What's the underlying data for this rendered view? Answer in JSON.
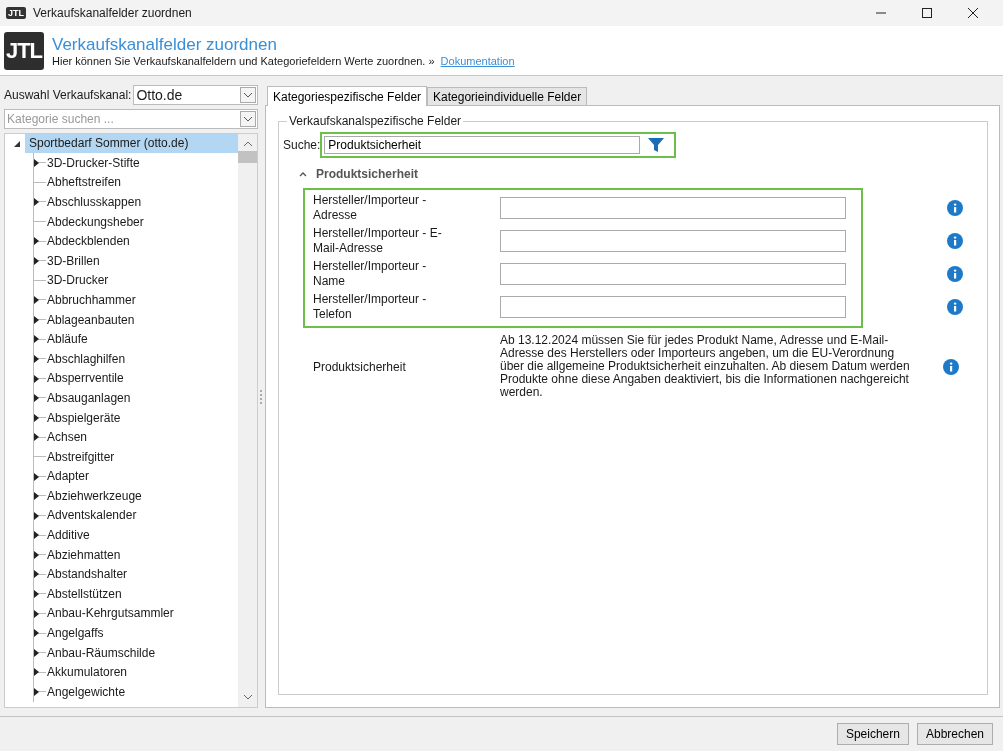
{
  "window": {
    "title": "Verkaufskanalfelder zuordnen",
    "logo": "JTL"
  },
  "header": {
    "logo": "JTL",
    "title": "Verkaufskanalfelder zuordnen",
    "subtitle": "Hier können Sie Verkaufskanalfeldern und Kategoriefeldern Werte zuordnen.",
    "separator": "»",
    "link": "Dokumentation"
  },
  "sidebar": {
    "channel_label": "Auswahl Verkaufskanal:",
    "channel_value": "Otto.de",
    "category_search": {
      "placeholder": "Kategorie suchen ..."
    },
    "tree": {
      "label": "Sportbedarf Sommer (otto.de)",
      "expanded": true,
      "selected": true,
      "children": [
        {
          "label": "3D-Drucker-Stifte",
          "expandable": true
        },
        {
          "label": "Abheftstreifen",
          "expandable": false
        },
        {
          "label": "Abschlusskappen",
          "expandable": true
        },
        {
          "label": "Abdeckungsheber",
          "expandable": false
        },
        {
          "label": "Abdeckblenden",
          "expandable": true
        },
        {
          "label": "3D-Brillen",
          "expandable": true
        },
        {
          "label": "3D-Drucker",
          "expandable": false
        },
        {
          "label": "Abbruchhammer",
          "expandable": true
        },
        {
          "label": "Ablageanbauten",
          "expandable": true
        },
        {
          "label": "Abläufe",
          "expandable": true
        },
        {
          "label": "Abschlaghilfen",
          "expandable": true
        },
        {
          "label": "Absperrventile",
          "expandable": true
        },
        {
          "label": "Absauganlagen",
          "expandable": true
        },
        {
          "label": "Abspielgeräte",
          "expandable": true
        },
        {
          "label": "Achsen",
          "expandable": true
        },
        {
          "label": "Abstreifgitter",
          "expandable": false
        },
        {
          "label": "Adapter",
          "expandable": true
        },
        {
          "label": "Abziehwerkzeuge",
          "expandable": true
        },
        {
          "label": "Adventskalender",
          "expandable": true
        },
        {
          "label": "Additive",
          "expandable": true
        },
        {
          "label": "Abziehmatten",
          "expandable": true
        },
        {
          "label": "Abstandshalter",
          "expandable": true
        },
        {
          "label": "Abstellstützen",
          "expandable": true
        },
        {
          "label": "Anbau-Kehrgutsammler",
          "expandable": true
        },
        {
          "label": "Angelgaffs",
          "expandable": true
        },
        {
          "label": "Anbau-Räumschilde",
          "expandable": true
        },
        {
          "label": "Akkumulatoren",
          "expandable": true
        },
        {
          "label": "Angelgewichte",
          "expandable": true
        }
      ]
    }
  },
  "tabs": [
    {
      "label": "Kategoriespezifische Felder",
      "selected": true
    },
    {
      "label": "Kategorieindividuelle Felder",
      "selected": false
    }
  ],
  "group": {
    "title": "Verkaufskanalspezifische Felder",
    "search_label": "Suche:",
    "search_value": "Produktsicherheit",
    "section": {
      "title": "Produktsicherheit",
      "expanded": true,
      "fields": [
        {
          "label": "Hersteller/Importeur - Adresse",
          "kind": "input"
        },
        {
          "label": "Hersteller/Importeur - E-Mail-Adresse",
          "kind": "input"
        },
        {
          "label": "Hersteller/Importeur - Name",
          "kind": "input"
        },
        {
          "label": "Hersteller/Importeur - Telefon",
          "kind": "input"
        },
        {
          "label": "Produktsicherheit",
          "kind": "note",
          "text": "Ab 13.12.2024 müssen Sie für jedes Produkt Name, Adresse und E-Mail-Adresse des Herstellers oder Importeurs angeben, um die EU-Verordnung über die allgemeine Produktsicherheit einzuhalten. Ab diesem Datum werden Produkte ohne diese Angaben deaktiviert, bis die Informationen nachgereicht werden."
        }
      ]
    }
  },
  "buttons": [
    "Speichern",
    "Abbrechen"
  ]
}
